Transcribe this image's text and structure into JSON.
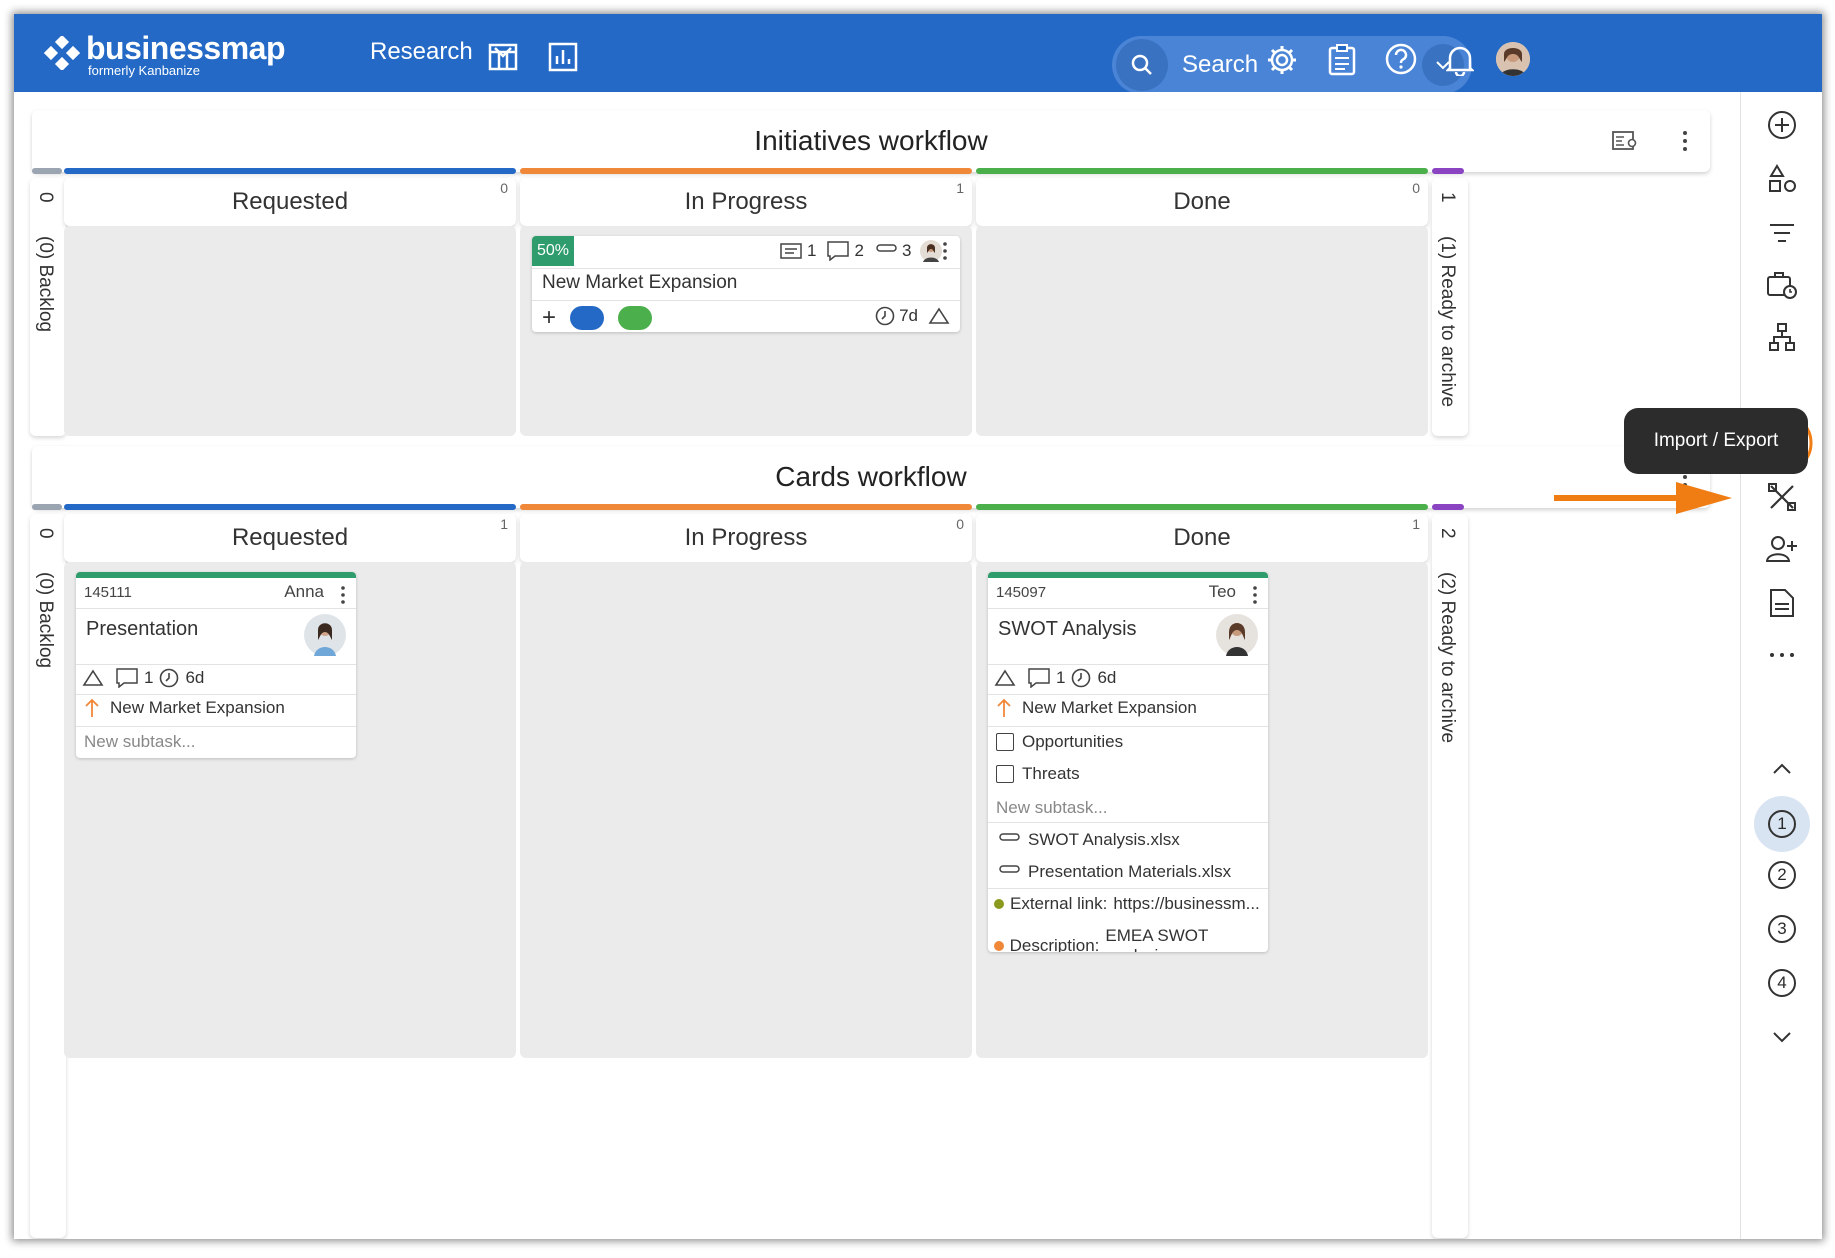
{
  "topbar": {
    "logo_name": "businessmap",
    "logo_sub": "formerly Kanbanize",
    "board_name": "Research",
    "search_placeholder": "Search"
  },
  "workflows": [
    {
      "title": "Initiatives workflow",
      "backlog_count": "0",
      "backlog_label": "(0) Backlog",
      "archive_count": "1",
      "archive_label": "(1) Ready to archive",
      "columns": [
        {
          "name": "Requested",
          "count": "0",
          "color": "#2369c5"
        },
        {
          "name": "In Progress",
          "count": "1",
          "color": "#f0883a"
        },
        {
          "name": "Done",
          "count": "0",
          "color": "#4bb04b"
        }
      ]
    },
    {
      "title": "Cards workflow",
      "backlog_count": "0",
      "backlog_label": "(0) Backlog",
      "archive_count": "2",
      "archive_label": "(2) Ready to archive",
      "columns": [
        {
          "name": "Requested",
          "count": "1",
          "color": "#2369c5"
        },
        {
          "name": "In Progress",
          "count": "0",
          "color": "#f0883a"
        },
        {
          "name": "Done",
          "count": "1",
          "color": "#4bb04b"
        }
      ]
    }
  ],
  "initiative_card": {
    "progress": "50%",
    "progress_value": 0.5,
    "desc_count": "1",
    "comments": "2",
    "attachments": "3",
    "title": "New Market Expansion",
    "time": "7d",
    "tag_colors": [
      "#2369c5",
      "#4bb04b"
    ]
  },
  "card1": {
    "id": "145111",
    "owner": "Anna",
    "title": "Presentation",
    "comments": "1",
    "time": "6d",
    "parent": "New Market Expansion",
    "subtask_placeholder": "New subtask..."
  },
  "card2": {
    "id": "145097",
    "owner": "Teo",
    "title": "SWOT Analysis",
    "comments": "1",
    "time": "6d",
    "parent": "New Market Expansion",
    "subtasks": [
      "Opportunities",
      "Threats"
    ],
    "subtask_placeholder": "New subtask...",
    "files": [
      "SWOT Analysis.xlsx",
      "Presentation Materials.xlsx"
    ],
    "fields": [
      {
        "label": "External link:",
        "value": "https://businessm...",
        "color": "#8a9a1c"
      },
      {
        "label": "Description:",
        "value": "EMEA SWOT analysis",
        "color": "#f0883a"
      }
    ]
  },
  "sidebar": {
    "tooltip": "Import / Export",
    "lanes": [
      "1",
      "2",
      "3",
      "4"
    ]
  },
  "colors": {
    "brand": "#2369c5",
    "highlight": "#f07d14",
    "progress": "#2e9c6c"
  }
}
